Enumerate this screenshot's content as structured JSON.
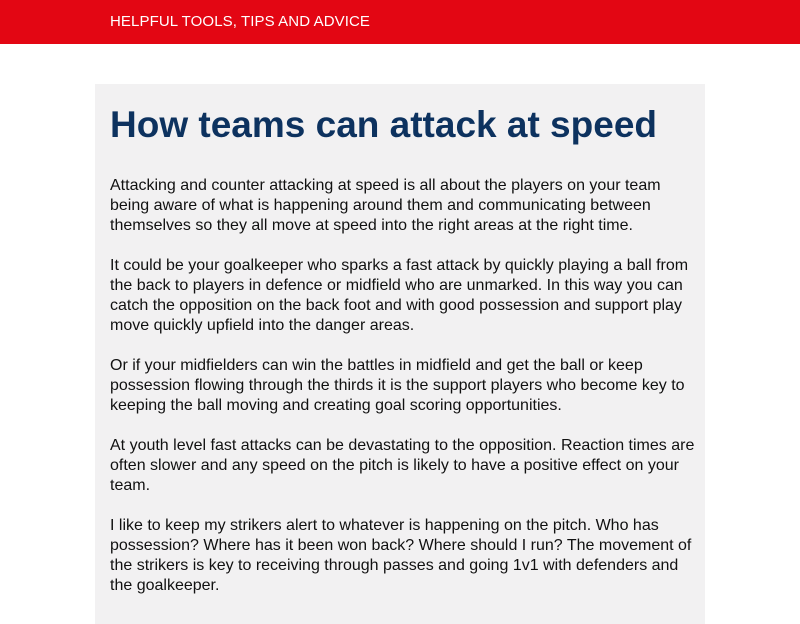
{
  "header": {
    "tagline": "HELPFUL TOOLS, TIPS AND ADVICE"
  },
  "article": {
    "title": "How teams can attack at speed",
    "paragraphs": [
      "Attacking and counter attacking at speed is all about the players on your team being aware of what is happening around them and communicating between themselves so they all move at speed into the right areas at the right time.",
      "It could be your goalkeeper who sparks a fast attack by quickly playing a ball from the back to players in defence or midfield who are unmarked. In this way you can catch the opposition on the back foot and with good possession and support play move quickly upfield into the danger areas.",
      "Or if your midfielders can win the battles in midfield and get the ball or keep possession flowing through the thirds it is the support players who become key to keeping the ball moving and creating goal scoring opportunities.",
      "At youth level fast attacks can be devastating to the opposition. Reaction times are often slower and any speed on the pitch is likely to have a positive effect on your team.",
      "I like to keep my strikers alert to whatever is happening on the pitch. Who has possession? Where has it been won back? Where should I run? The movement of the strikers is key to receiving through passes and going 1v1 with defenders and the goalkeeper."
    ]
  },
  "colors": {
    "header_bg": "#e30613",
    "title": "#0d325f",
    "panel_bg": "#f2f1f2"
  }
}
